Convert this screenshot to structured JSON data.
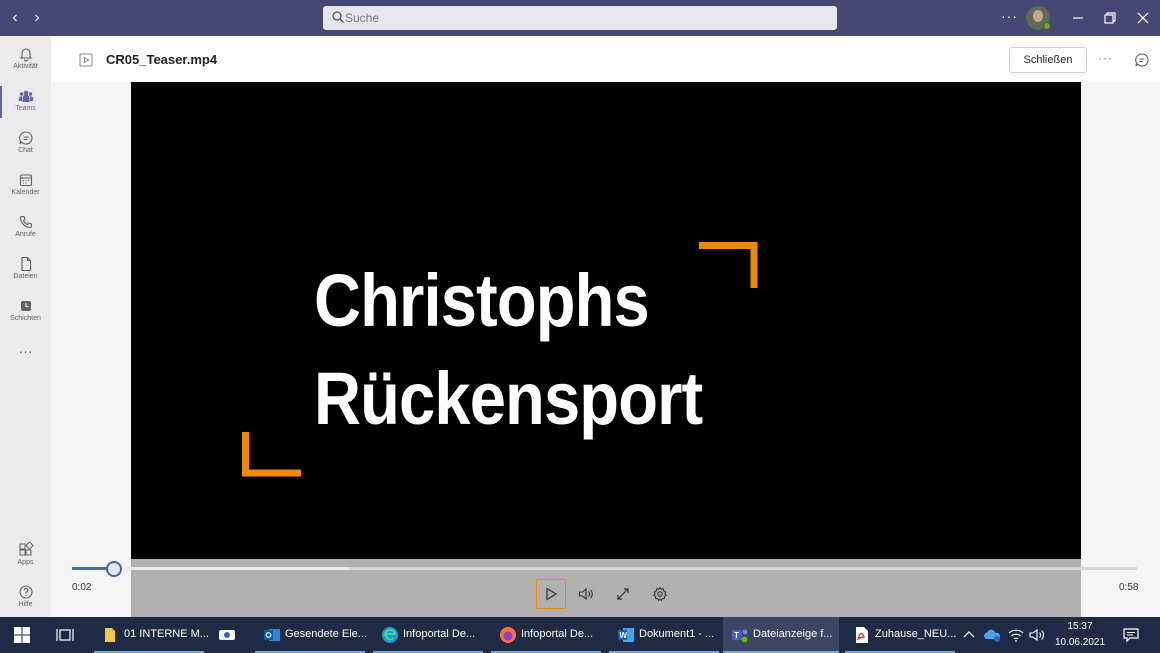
{
  "titlebar": {
    "search_placeholder": "Suche"
  },
  "rail": {
    "items": [
      {
        "label": "Aktivität",
        "icon": "bell-icon"
      },
      {
        "label": "Teams",
        "icon": "teams-icon"
      },
      {
        "label": "Chat",
        "icon": "chat-icon"
      },
      {
        "label": "Kalender",
        "icon": "calendar-icon"
      },
      {
        "label": "Anrufe",
        "icon": "phone-icon"
      },
      {
        "label": "Dateien",
        "icon": "file-icon"
      },
      {
        "label": "Schichten",
        "icon": "clock-icon"
      }
    ],
    "more_label": "···",
    "apps_label": "Apps",
    "help_label": "Hilfe"
  },
  "header": {
    "file_name": "CR05_Teaser.mp4",
    "close_label": "Schließen"
  },
  "video": {
    "title_line1": "Christophs",
    "title_line2": "Rückensport",
    "accent_color": "#f18a00"
  },
  "player": {
    "current_time": "0:02",
    "duration": "0:58",
    "progress_fraction": 0.039,
    "buffered_fraction": 0.26
  },
  "taskbar": {
    "apps": [
      {
        "label": "01 INTERNE M...",
        "icon": "folder-icon"
      },
      {
        "label": "",
        "icon": "camera-app-icon"
      },
      {
        "label": "Gesendete Ele...",
        "icon": "outlook-icon"
      },
      {
        "label": "Infoportal De...",
        "icon": "edge-icon"
      },
      {
        "label": "Infoportal De...",
        "icon": "firefox-icon"
      },
      {
        "label": "Dokument1 - ...",
        "icon": "word-icon"
      },
      {
        "label": "Dateianzeige f...",
        "icon": "teams-app-icon"
      },
      {
        "label": "Zuhause_NEU...",
        "icon": "pdf-icon"
      }
    ],
    "clock_time": "15:37",
    "clock_date": "10.06.2021"
  }
}
